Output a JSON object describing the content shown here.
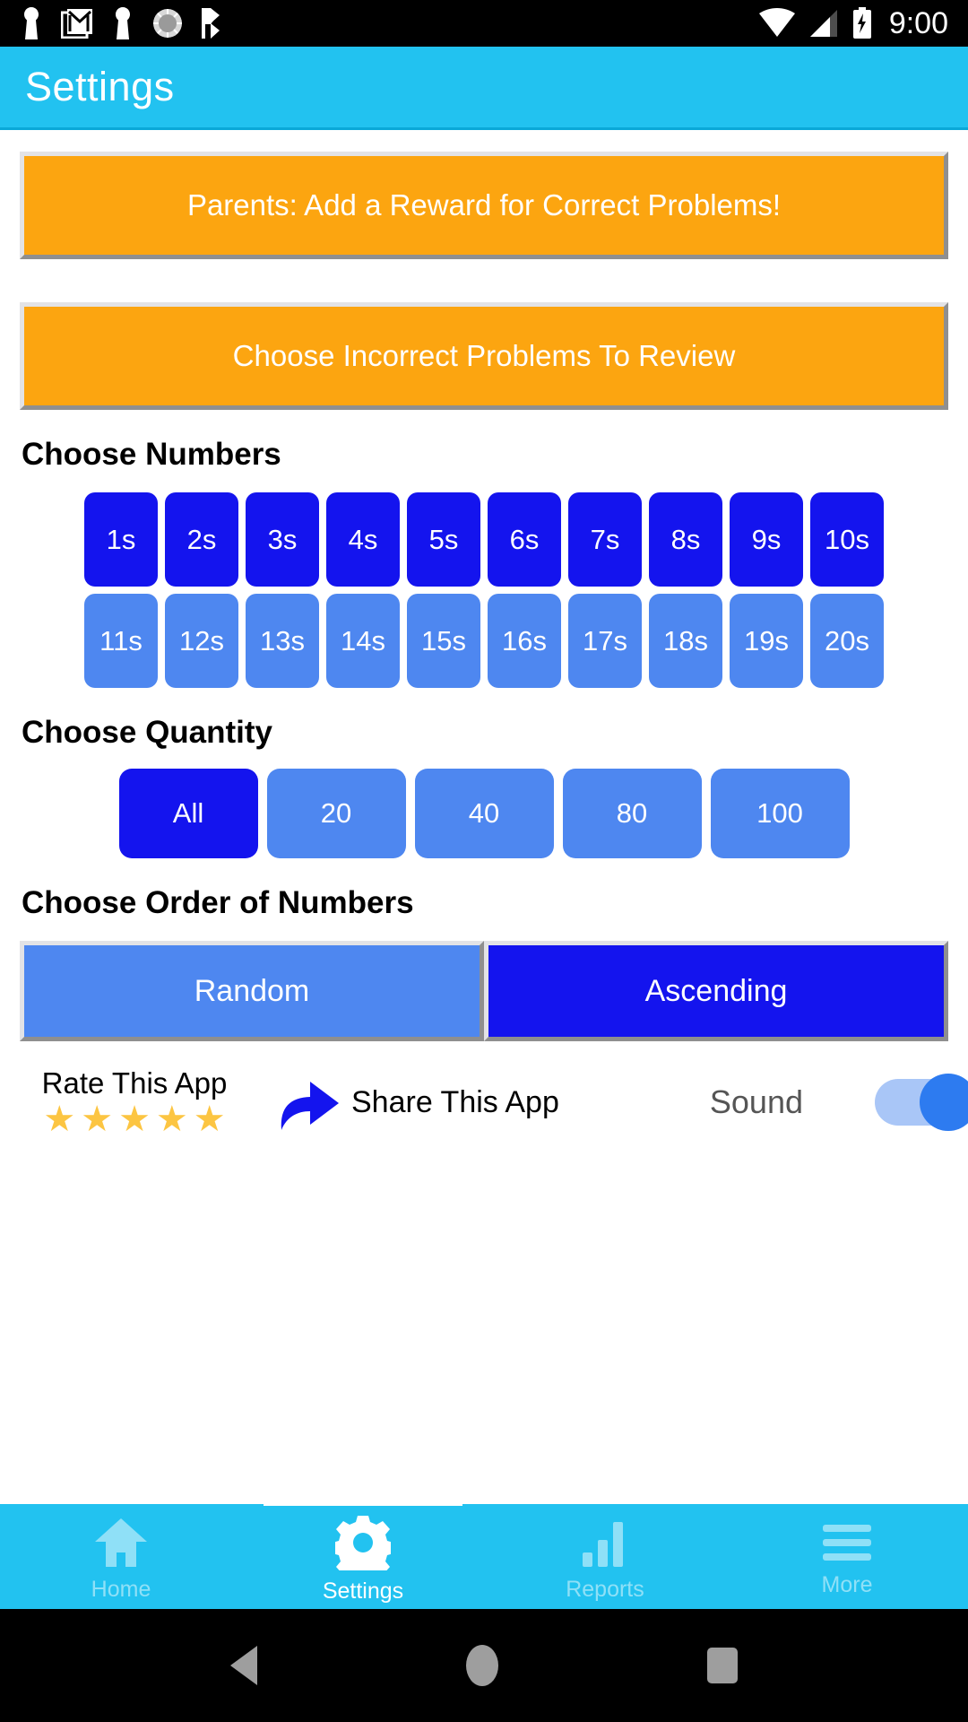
{
  "statusbar": {
    "time": "9:00",
    "icons": [
      "keyhole-icon",
      "gmail-icon",
      "keyhole-icon",
      "clock-dial-icon",
      "checkmark-flag-icon"
    ],
    "right_icons": [
      "wifi-icon",
      "cell-signal-icon",
      "battery-charging-icon"
    ]
  },
  "appbar": {
    "title": "Settings"
  },
  "buttons": {
    "reward": "Parents: Add a Reward for Correct Problems!",
    "review": "Choose Incorrect Problems To Review"
  },
  "sections": {
    "numbers_title": "Choose Numbers",
    "quantity_title": "Choose Quantity",
    "order_title": "Choose Order of Numbers"
  },
  "numbers": {
    "row1": [
      {
        "label": "1s",
        "selected": true
      },
      {
        "label": "2s",
        "selected": true
      },
      {
        "label": "3s",
        "selected": true
      },
      {
        "label": "4s",
        "selected": true
      },
      {
        "label": "5s",
        "selected": true
      },
      {
        "label": "6s",
        "selected": true
      },
      {
        "label": "7s",
        "selected": true
      },
      {
        "label": "8s",
        "selected": true
      },
      {
        "label": "9s",
        "selected": true
      },
      {
        "label": "10s",
        "selected": true
      }
    ],
    "row2": [
      {
        "label": "11s",
        "selected": false
      },
      {
        "label": "12s",
        "selected": false
      },
      {
        "label": "13s",
        "selected": false
      },
      {
        "label": "14s",
        "selected": false
      },
      {
        "label": "15s",
        "selected": false
      },
      {
        "label": "16s",
        "selected": false
      },
      {
        "label": "17s",
        "selected": false
      },
      {
        "label": "18s",
        "selected": false
      },
      {
        "label": "19s",
        "selected": false
      },
      {
        "label": "20s",
        "selected": false
      }
    ]
  },
  "quantity": [
    {
      "label": "All",
      "selected": true
    },
    {
      "label": "20",
      "selected": false
    },
    {
      "label": "40",
      "selected": false
    },
    {
      "label": "80",
      "selected": false
    },
    {
      "label": "100",
      "selected": false
    }
  ],
  "order": [
    {
      "label": "Random",
      "selected": false
    },
    {
      "label": "Ascending",
      "selected": true
    }
  ],
  "actions": {
    "rate_label": "Rate This App",
    "star_count": 5,
    "star_glyph": "★",
    "share_label": "Share This App",
    "sound_label": "Sound",
    "sound_on": true
  },
  "bottomnav": [
    {
      "label": "Home",
      "icon": "home-icon",
      "active": false
    },
    {
      "label": "Settings",
      "icon": "gear-icon",
      "active": true
    },
    {
      "label": "Reports",
      "icon": "bar-chart-icon",
      "active": false
    },
    {
      "label": "More",
      "icon": "hamburger-icon",
      "active": false
    }
  ],
  "androidnav": [
    "back-icon",
    "home-icon",
    "recents-icon"
  ],
  "colors": {
    "accent": "#22C2F0",
    "orange": "#FCA510",
    "selected_blue": "#1414EE",
    "unselected_blue": "#4E87F0",
    "star_gold": "#FCC542"
  }
}
